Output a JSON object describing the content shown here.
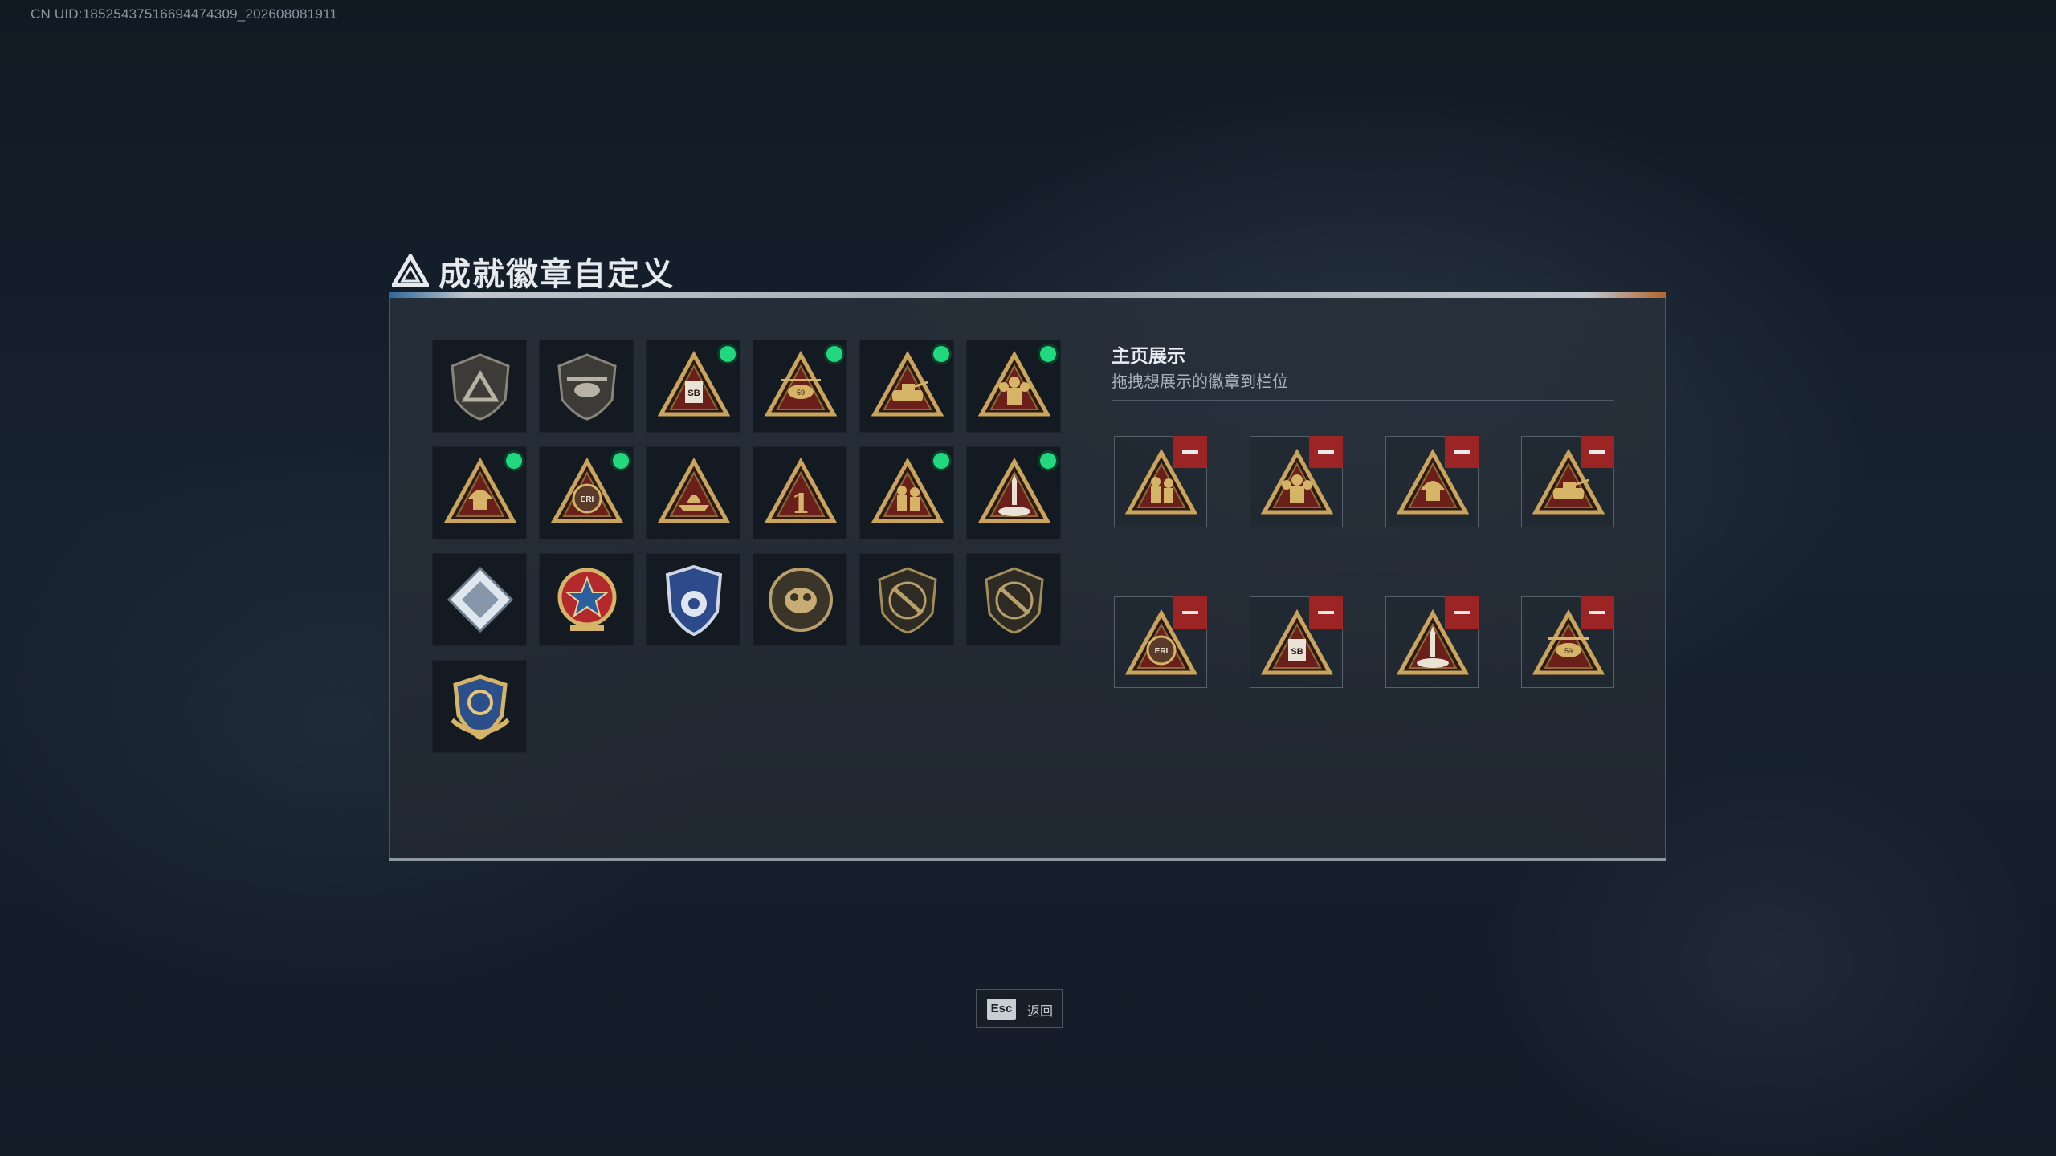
{
  "uid_text": "CN UID:18525437516694474309_202608081911",
  "page": {
    "title": "成就徽章自定义",
    "title_icon": "delta-logo-icon"
  },
  "badges": [
    {
      "name": "delta-shield",
      "new": false
    },
    {
      "name": "helicopter-shield",
      "new": false
    },
    {
      "name": "sb-tower",
      "new": true
    },
    {
      "name": "helicopter-59",
      "new": true
    },
    {
      "name": "tank",
      "new": true
    },
    {
      "name": "squad",
      "new": true
    },
    {
      "name": "soldier-helmet",
      "new": true
    },
    {
      "name": "eri-globe",
      "new": true
    },
    {
      "name": "ship",
      "new": false
    },
    {
      "name": "number-one",
      "new": false
    },
    {
      "name": "infantry",
      "new": true
    },
    {
      "name": "rocket-launch",
      "new": true
    },
    {
      "name": "circuit-diamond",
      "new": false
    },
    {
      "name": "star-medal",
      "new": false
    },
    {
      "name": "police-shield",
      "new": false
    },
    {
      "name": "gas-mask-coin",
      "new": false
    },
    {
      "name": "rifle-shield",
      "new": false
    },
    {
      "name": "rifle-shield-dark",
      "new": false
    },
    {
      "name": "wings-crest",
      "new": false
    }
  ],
  "showcase": {
    "title": "主页展示",
    "subtitle": "拖拽想展示的徽章到栏位",
    "slots": [
      "infantry",
      "squad",
      "soldier-helmet",
      "tank",
      "eri-globe",
      "sb-tower",
      "rocket-launch",
      "helicopter-59"
    ],
    "remove_icon": "minus-icon"
  },
  "footer": {
    "esc_key": "Esc",
    "back_label": "返回"
  },
  "colors": {
    "accent_green": "#21d87f",
    "remove_red": "#9c2424",
    "badge_gold": "#c9a45a"
  }
}
